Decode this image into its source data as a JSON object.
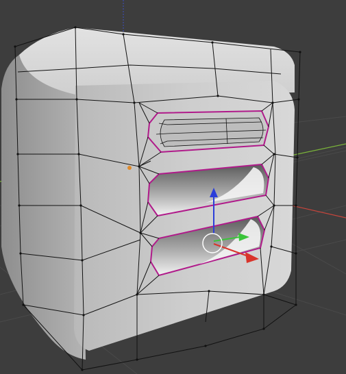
{
  "viewport": {
    "view_label": "",
    "background": "#3d3d3d",
    "grid_line_color": "#4a4a4a",
    "axis_colors": {
      "x": "#c8453c",
      "y": "#7ab33a",
      "z": "#3a4ec2"
    }
  },
  "mesh": {
    "surface_color": "#c6c6c6",
    "wire_color": "#111111",
    "selected_edge_color": "#b01a8a",
    "active_vertex_color": "#e08a2a"
  },
  "gizmo": {
    "mode": "translate",
    "colors": {
      "x": "#d9342b",
      "y": "#3ac43a",
      "z": "#2b3ed9",
      "center": "#ffffff"
    }
  },
  "slots": [
    "top-slot",
    "middle-slot",
    "bottom-slot"
  ]
}
